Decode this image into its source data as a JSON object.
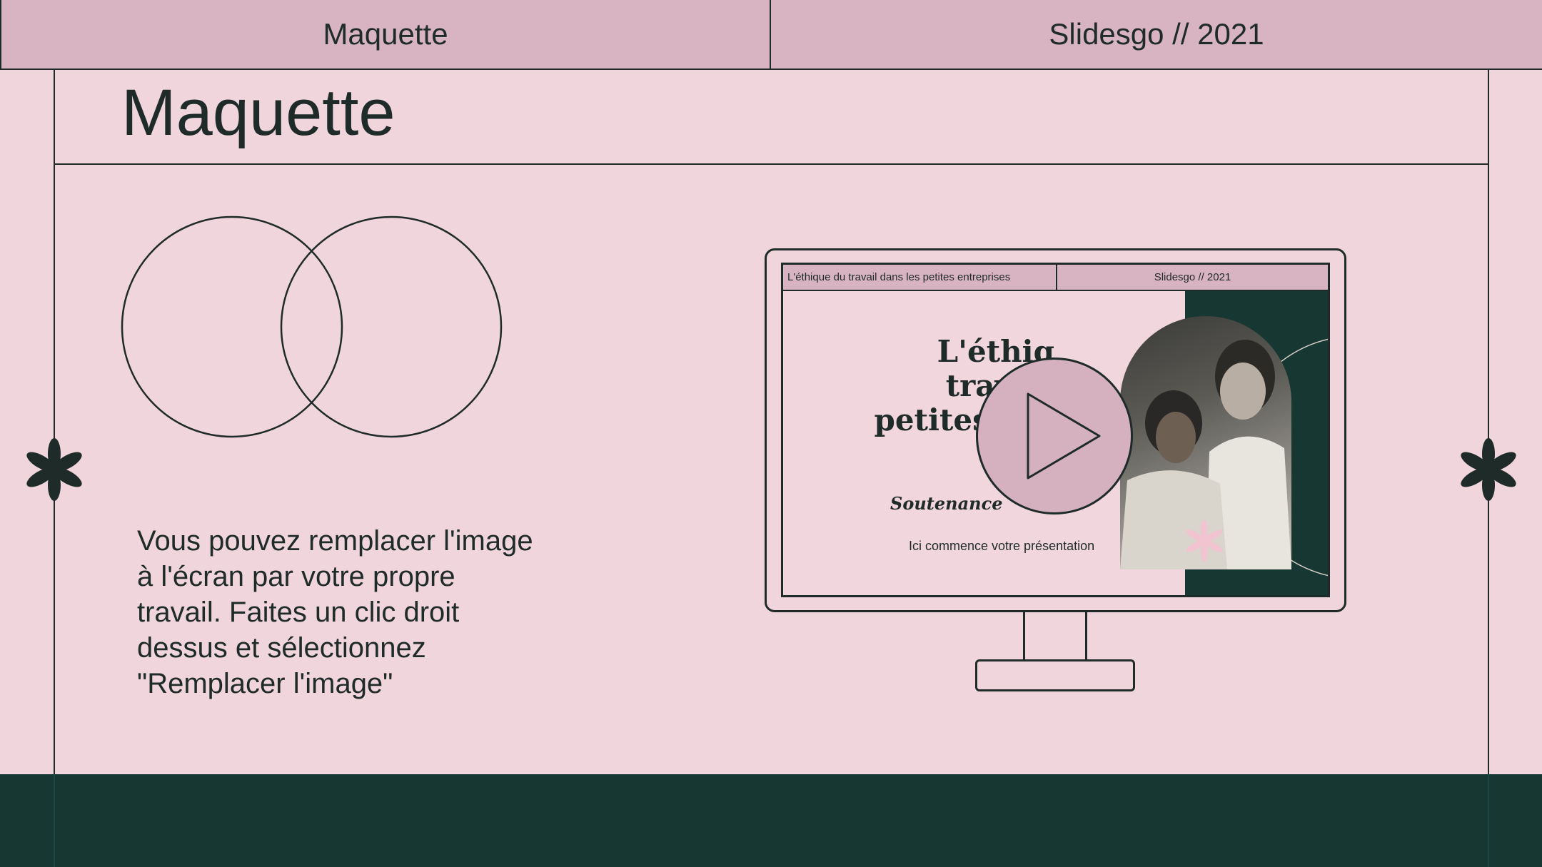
{
  "header": {
    "left_label": "Maquette",
    "right_label": "Slidesgo // 2021"
  },
  "slide": {
    "title": "Maquette",
    "body": "Vous pouvez remplacer l'image à l'écran par votre propre travail. Faites un clic droit dessus et sélectionnez \"Remplacer l'image\""
  },
  "monitor_screen": {
    "top_left": "L'éthique du travail dans les petites entreprises",
    "top_right": "Slidesgo // 2021",
    "title_line1": "L'éthiq",
    "title_line2": "travail",
    "title_line3": "petites ent",
    "subtitle": "Soutenance",
    "caption": "Ici commence votre présentation"
  },
  "icons": {
    "left_deco": "asterisk-icon",
    "right_deco": "asterisk-icon",
    "play": "play-icon",
    "venn": "venn-diagram-icon"
  },
  "colors": {
    "background": "#f1d5dc",
    "header_pink": "#d8b3c1",
    "dark_green": "#173832",
    "ink": "#1e2b29"
  }
}
